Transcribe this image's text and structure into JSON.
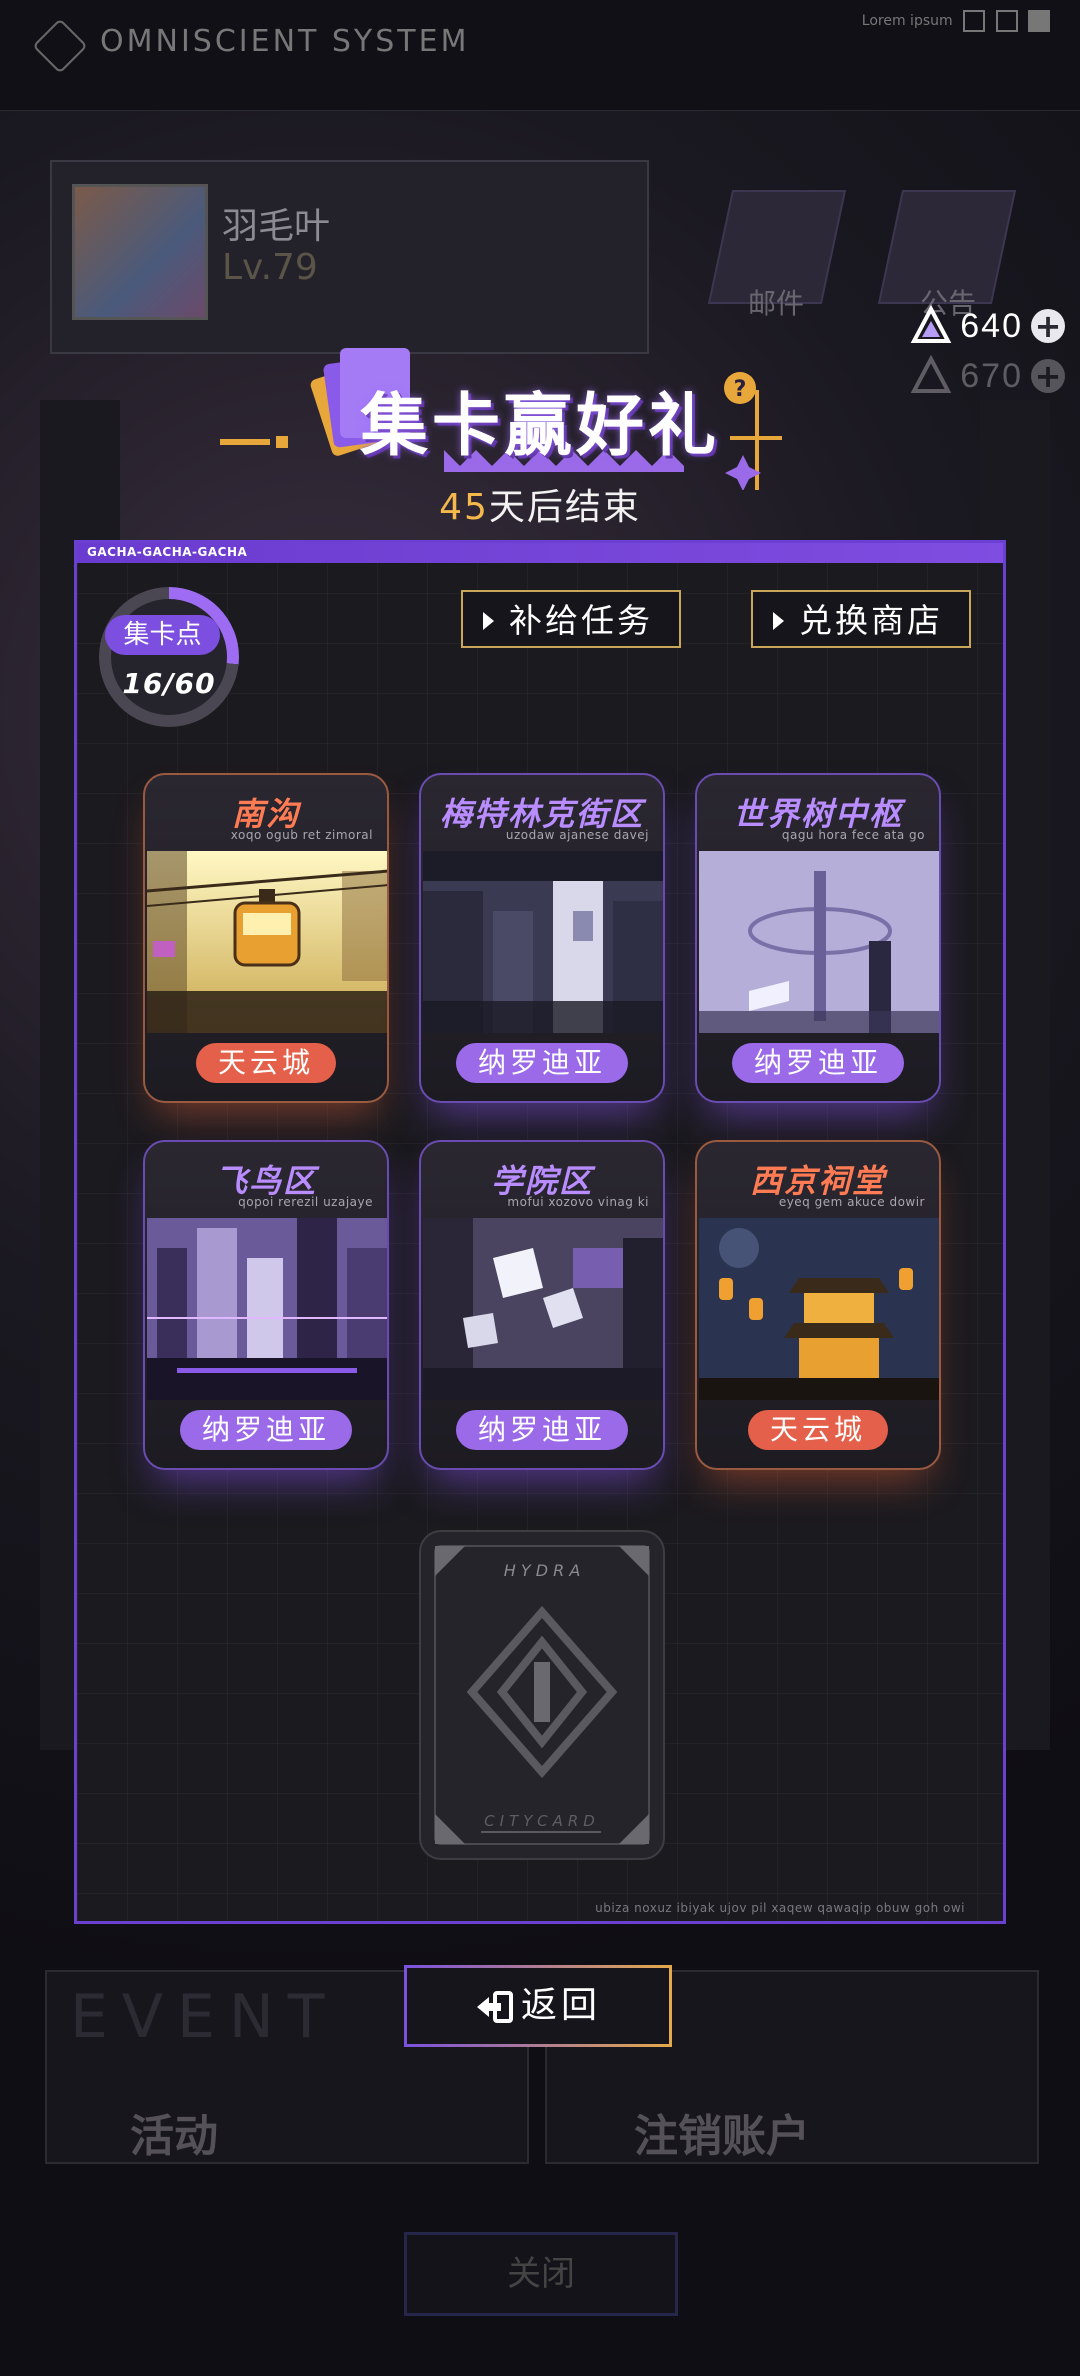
{
  "background": {
    "system_title": "OMNISCIENT SYSTEM",
    "top_right_text": "Lorem ipsum",
    "player_name": "羽毛叶",
    "player_level": "Lv.79",
    "icon_labels": [
      "邮件",
      "公告"
    ],
    "event_title": "EVENT",
    "event_labels": [
      "活动",
      "注销账户"
    ],
    "close_label": "关闭"
  },
  "currency": {
    "value": "640",
    "icon": "triangle-crystal-icon",
    "ghost_value": "670"
  },
  "header": {
    "title": "集卡赢好礼",
    "ends_days": "45",
    "ends_text": "天后结束"
  },
  "panel": {
    "tag": "GACHA-GACHA-GACHA",
    "footer": "ubiza noxuz ibiyak ujov pil xaqew qawaqip obuw goh owi"
  },
  "points": {
    "label": "集卡点",
    "value": "16/60",
    "current": 16,
    "max": 60
  },
  "buttons": {
    "supply_task": "补给任务",
    "exchange_shop": "兑换商店",
    "return": "返回"
  },
  "cards": [
    {
      "name": "南沟",
      "sub": "xoqo ogub ret zimoral",
      "tag": "天云城",
      "theme": "orange"
    },
    {
      "name": "梅特林克街区",
      "sub": "uzodaw ajanese davej",
      "tag": "纳罗迪亚",
      "theme": "purple"
    },
    {
      "name": "世界树中枢",
      "sub": "qagu hora fece ata go",
      "tag": "纳罗迪亚",
      "theme": "purple"
    },
    {
      "name": "飞鸟区",
      "sub": "qopoi rerezil uzajaye",
      "tag": "纳罗迪亚",
      "theme": "purple"
    },
    {
      "name": "学院区",
      "sub": "mofui xozovo vinag ki",
      "tag": "纳罗迪亚",
      "theme": "purple"
    },
    {
      "name": "西京祠堂",
      "sub": "eyeq gem akuce dowir",
      "tag": "天云城",
      "theme": "orange"
    }
  ],
  "locked_card": {
    "top_text": "H Y D R A",
    "bottom_text": "CITYCARD"
  },
  "colors": {
    "accent_purple": "#7c4fe0",
    "accent_orange": "#e4604a",
    "gold": "#c9a65a"
  }
}
